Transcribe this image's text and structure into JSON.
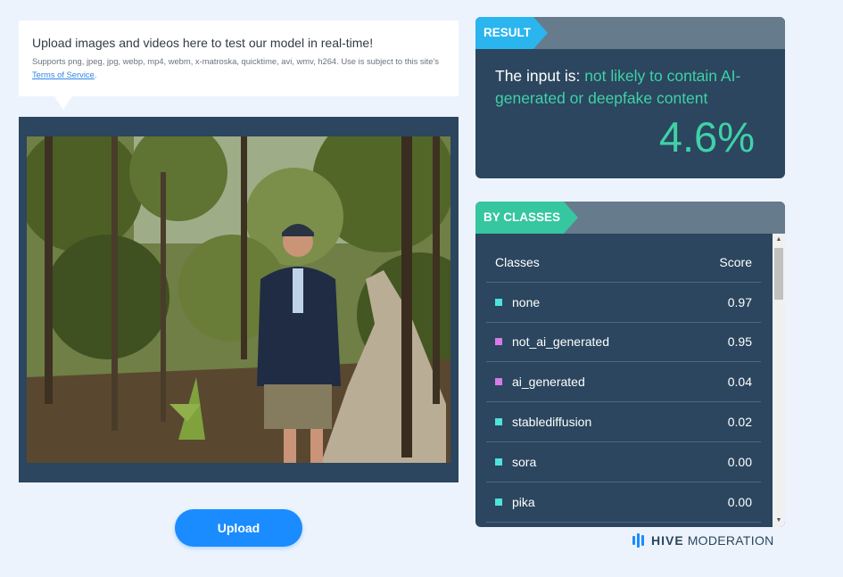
{
  "upload_info": {
    "title": "Upload images and videos here to test our model in real-time!",
    "subtitle": "Supports png, jpeg, jpg, webp, mp4, webm, x-matroska, quicktime, avi, wmv, h264. Use is subject to this site's ",
    "terms_link": "Terms of Service",
    "terms_suffix": "."
  },
  "upload_button": {
    "label": "Upload"
  },
  "result": {
    "tag": "RESULT",
    "prefix": "The input is: ",
    "verdict": "not likely to contain AI-generated or deepfake content",
    "score": "4.6%"
  },
  "by_classes": {
    "tag": "BY CLASSES",
    "header": {
      "classes": "Classes",
      "score": "Score"
    },
    "rows": [
      {
        "name": "none",
        "score": "0.97",
        "color": "#4fe3dc"
      },
      {
        "name": "not_ai_generated",
        "score": "0.95",
        "color": "#d77be8"
      },
      {
        "name": "ai_generated",
        "score": "0.04",
        "color": "#d77be8"
      },
      {
        "name": "stablediffusion",
        "score": "0.02",
        "color": "#4fe3dc"
      },
      {
        "name": "sora",
        "score": "0.00",
        "color": "#4fe3dc"
      },
      {
        "name": "pika",
        "score": "0.00",
        "color": "#4fe3dc"
      }
    ]
  },
  "logo": {
    "brand": "HIVE",
    "sub": "MODERATION"
  },
  "colors": {
    "accent_blue": "#1a8cff",
    "result_tag": "#2ab5ef",
    "classes_tag": "#36c6a0",
    "panel_bg": "#2b465e",
    "verdict_green": "#3fd1a8"
  }
}
